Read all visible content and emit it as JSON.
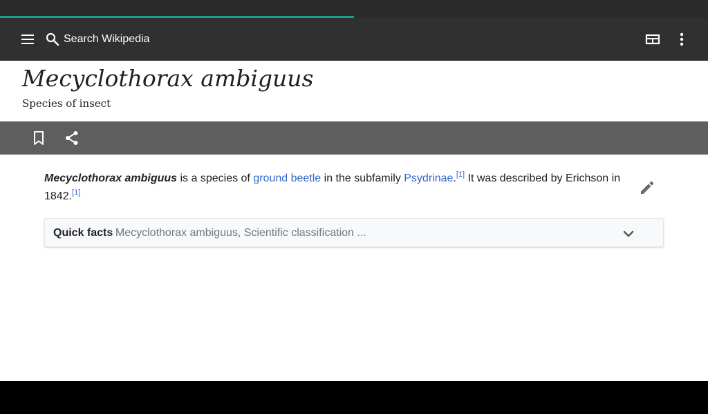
{
  "progress": {
    "fraction": 0.5
  },
  "toolbar": {
    "search_placeholder": "Search Wikipedia",
    "menu_icon": "hamburger-menu-icon",
    "search_icon": "search-icon",
    "reading_list_icon": "reading-list-icon",
    "overflow_icon": "more-vertical-icon"
  },
  "article": {
    "title": "Mecyclothorax ambiguus",
    "description": "Species of insect",
    "lead": {
      "subject": "Mecyclothorax ambiguus",
      "text1": " is a species of ",
      "link1": "ground beetle",
      "text2": " in the subfamily ",
      "link2": "Psydrinae",
      "text3": ".",
      "ref1": "[1]",
      "text4": " It was described by Erichson in 1842.",
      "ref2": "[1]"
    },
    "quick_facts": {
      "label": "Quick facts",
      "text": ": Mecyclothorax ambiguus, Scientific classification ..."
    }
  },
  "actions": {
    "bookmark_icon": "bookmark-icon",
    "share_icon": "share-icon",
    "edit_icon": "edit-pencil-icon"
  },
  "colors": {
    "accent": "#1b9c87",
    "link": "#3366cc",
    "toolbar": "#303030",
    "action_bar": "#5e5e5e"
  }
}
